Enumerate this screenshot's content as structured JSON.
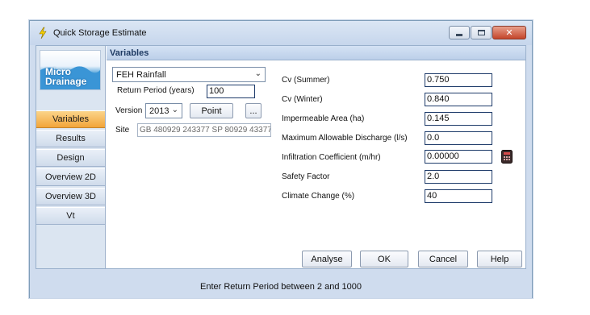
{
  "window": {
    "title": "Quick Storage Estimate",
    "controls": {
      "minimize": "minimize",
      "maximize": "maximize",
      "close": "✕"
    }
  },
  "sidebar": {
    "logo_text_line1": "Micro",
    "logo_text_line2": "Drainage",
    "items": [
      {
        "label": "Variables",
        "active": true
      },
      {
        "label": "Results",
        "active": false
      },
      {
        "label": "Design",
        "active": false
      },
      {
        "label": "Overview 2D",
        "active": false
      },
      {
        "label": "Overview 3D",
        "active": false
      },
      {
        "label": "Vt",
        "active": false
      }
    ]
  },
  "variables": {
    "header": "Variables",
    "rainfall_type": "FEH Rainfall",
    "return_period_label": "Return Period (years)",
    "return_period_value": "100",
    "version_label": "Version",
    "version_value": "2013",
    "point_button": "Point",
    "ellipsis_button": "...",
    "site_label": "Site",
    "site_value": "GB 480929 243377 SP 80929 43377",
    "fields": [
      {
        "label": "Cv (Summer)",
        "value": "0.750"
      },
      {
        "label": "Cv (Winter)",
        "value": "0.840"
      },
      {
        "label": "Impermeable Area (ha)",
        "value": "0.145"
      },
      {
        "label": "Maximum Allowable Discharge (l/s)",
        "value": "0.0"
      },
      {
        "label": "Infiltration Coefficient (m/hr)",
        "value": "0.00000"
      },
      {
        "label": "Safety Factor",
        "value": "2.0"
      },
      {
        "label": "Climate Change (%)",
        "value": "40"
      }
    ]
  },
  "buttons": {
    "analyse": "Analyse",
    "ok": "OK",
    "cancel": "Cancel",
    "help": "Help"
  },
  "status": "Enter Return Period between 2 and 1000",
  "colors": {
    "active_tab": "#f2a53a",
    "header_text": "#1f3b63",
    "window_frame": "#cfdcee"
  }
}
